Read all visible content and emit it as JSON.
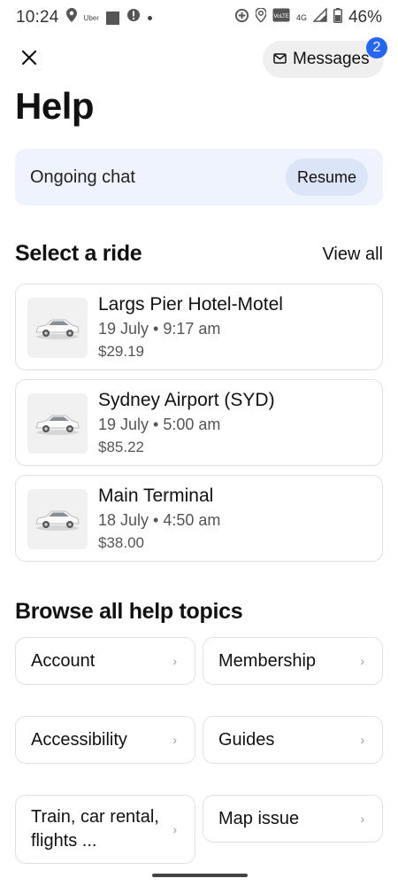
{
  "status_bar": {
    "time": "10:24",
    "app_label": "Uber",
    "network": "4G",
    "volte": "VoLTE",
    "battery": "46%"
  },
  "header": {
    "messages_label": "Messages",
    "messages_badge": "2",
    "title": "Help"
  },
  "chat_banner": {
    "label": "Ongoing chat",
    "resume_label": "Resume"
  },
  "rides_section": {
    "title": "Select a ride",
    "view_all": "View all",
    "rides": [
      {
        "name": "Largs Pier Hotel-Motel",
        "date": "19 July • 9:17 am",
        "price": "$29.19"
      },
      {
        "name": "Sydney Airport (SYD)",
        "date": "19 July • 5:00 am",
        "price": "$85.22"
      },
      {
        "name": "Main Terminal",
        "date": "18 July • 4:50 am",
        "price": "$38.00"
      }
    ]
  },
  "topics_section": {
    "title": "Browse all help topics",
    "topics": [
      {
        "label": "Account"
      },
      {
        "label": "Membership"
      },
      {
        "label": "Accessibility"
      },
      {
        "label": "Guides"
      },
      {
        "label": "Train, car rental, flights ..."
      },
      {
        "label": "Map issue"
      }
    ]
  },
  "icons": {
    "close": "close-icon",
    "messages": "envelope-icon",
    "chevron": "chevron-right-icon",
    "car": "car-icon"
  },
  "colors": {
    "badge": "#2767f0",
    "chat_banner": "#eef3fd",
    "resume_button": "#dbe5f7"
  }
}
